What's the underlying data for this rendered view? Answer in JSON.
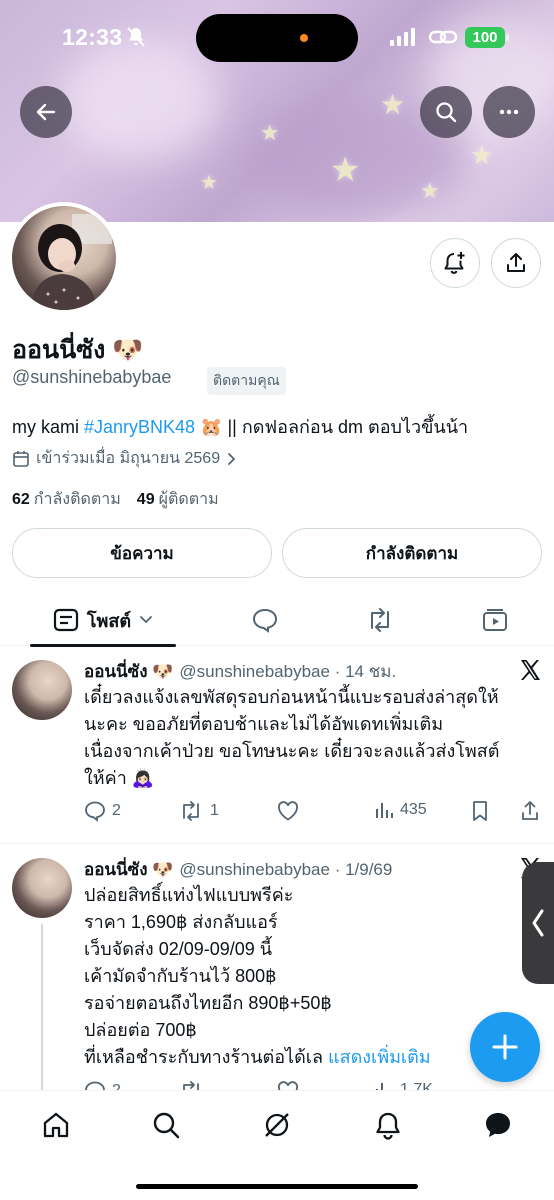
{
  "status_bar": {
    "time": "12:33",
    "battery": "100"
  },
  "profile": {
    "display_name": "ออนนี่ซัง 🐶",
    "handle": "@sunshinebabybae",
    "follows_you": "ติดตามคุณ",
    "bio_prefix": "my kami ",
    "bio_hashtag": "#JanryBNK48",
    "bio_suffix": " 🐹 || กดฟอลก่อน dm ตอบไวขึ้นน้า",
    "joined": "เข้าร่วมเมื่อ มิถุนายน 2569",
    "following_count": "62",
    "following_label": "กำลังติดตาม",
    "followers_count": "49",
    "followers_label": "ผู้ติดตาม",
    "message_button": "ข้อความ",
    "following_button": "กำลังติดตาม"
  },
  "tabs": {
    "posts_label": "โพสต์"
  },
  "posts": [
    {
      "name": "ออนนี่ซัง 🐶",
      "handle": "@sunshinebabybae",
      "time": "· 14 ชม.",
      "lines": [
        "เดี๋ยวลงแจ้งเลขพัสดุรอบก่อนหน้านี้แบะรอบส่งล่าสุดให้",
        "นะคะ ขออภัยที่ตอบช้าและไม่ได้อัพเดทเพิ่มเติม",
        "เนื่องจากเค้าป่วย ขอโทษนะคะ เดี๋ยวจะลงแล้วส่งโพสต์",
        "ให้ค่า 🙇🏻‍♀️"
      ],
      "replies": "2",
      "reposts": "1",
      "views": "435"
    },
    {
      "name": "ออนนี่ซัง 🐶",
      "handle": "@sunshinebabybae",
      "time": "· 1/9/69",
      "lines": [
        "ปล่อยสิทธิ์แท่งไฟแบบพรีค่ะ",
        "ราคา 1,690฿ ส่งกลับแอร์",
        "เว็บจัดส่ง 02/09-09/09 นี้",
        "เค้ามัดจำกับร้านไว้ 800฿",
        "รอจ่ายตอนถึงไทยอีก 890฿+50฿",
        "ปล่อยต่อ 700฿",
        "ที่เหลือชำระกับทางร้านต่อได้เล "
      ],
      "show_more": "แสดงเพิ่มเติม",
      "replies": "2",
      "views": "1.7K"
    }
  ],
  "colors": {
    "accent": "#1d9bf0",
    "battery": "#34c759",
    "text": "#0f1419",
    "muted": "#536471"
  },
  "icons": [
    "back-arrow-icon",
    "search-icon",
    "more-icon",
    "bell-plus-icon",
    "share-icon",
    "calendar-icon",
    "chevron-right-icon",
    "posts-icon",
    "chevron-down-icon",
    "reply-icon",
    "repost-icon",
    "media-icon",
    "like-icon",
    "views-icon",
    "bookmark-icon",
    "x-logo-icon",
    "plus-icon",
    "home-icon",
    "explore-icon",
    "grok-icon",
    "notifications-icon",
    "messages-icon"
  ]
}
